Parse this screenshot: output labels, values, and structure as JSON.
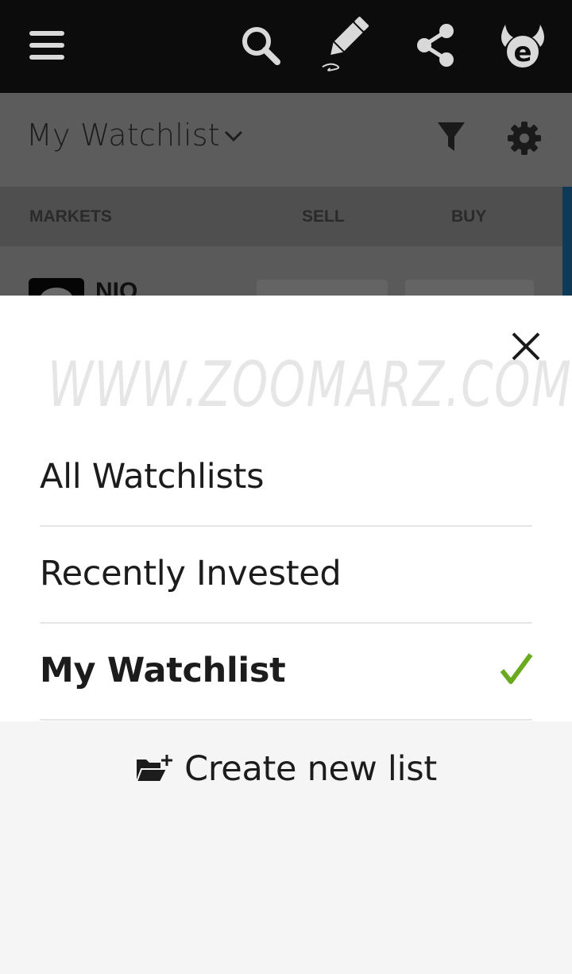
{
  "topbar": {
    "icons": [
      "hamburger-menu-icon",
      "search-icon",
      "pencil-icon",
      "share-icon",
      "etoro-logo-icon"
    ]
  },
  "header": {
    "title": "My Watchlist"
  },
  "columns": {
    "markets": "MARKETS",
    "sell": "SELL",
    "buy": "BUY"
  },
  "row": {
    "ticker": "NIO"
  },
  "sheet": {
    "watermark": "WWW.ZOOMARZ.COM",
    "options": [
      {
        "label": "All Watchlists",
        "selected": false
      },
      {
        "label": "Recently Invested",
        "selected": false
      },
      {
        "label": "My Watchlist",
        "selected": true
      }
    ],
    "create_label": "Create new list"
  },
  "colors": {
    "topbar": "#0c0c0c",
    "check_green": "#6aaa1e",
    "sheet_bg": "#ffffff",
    "footer_bg": "#f5f5f5"
  }
}
